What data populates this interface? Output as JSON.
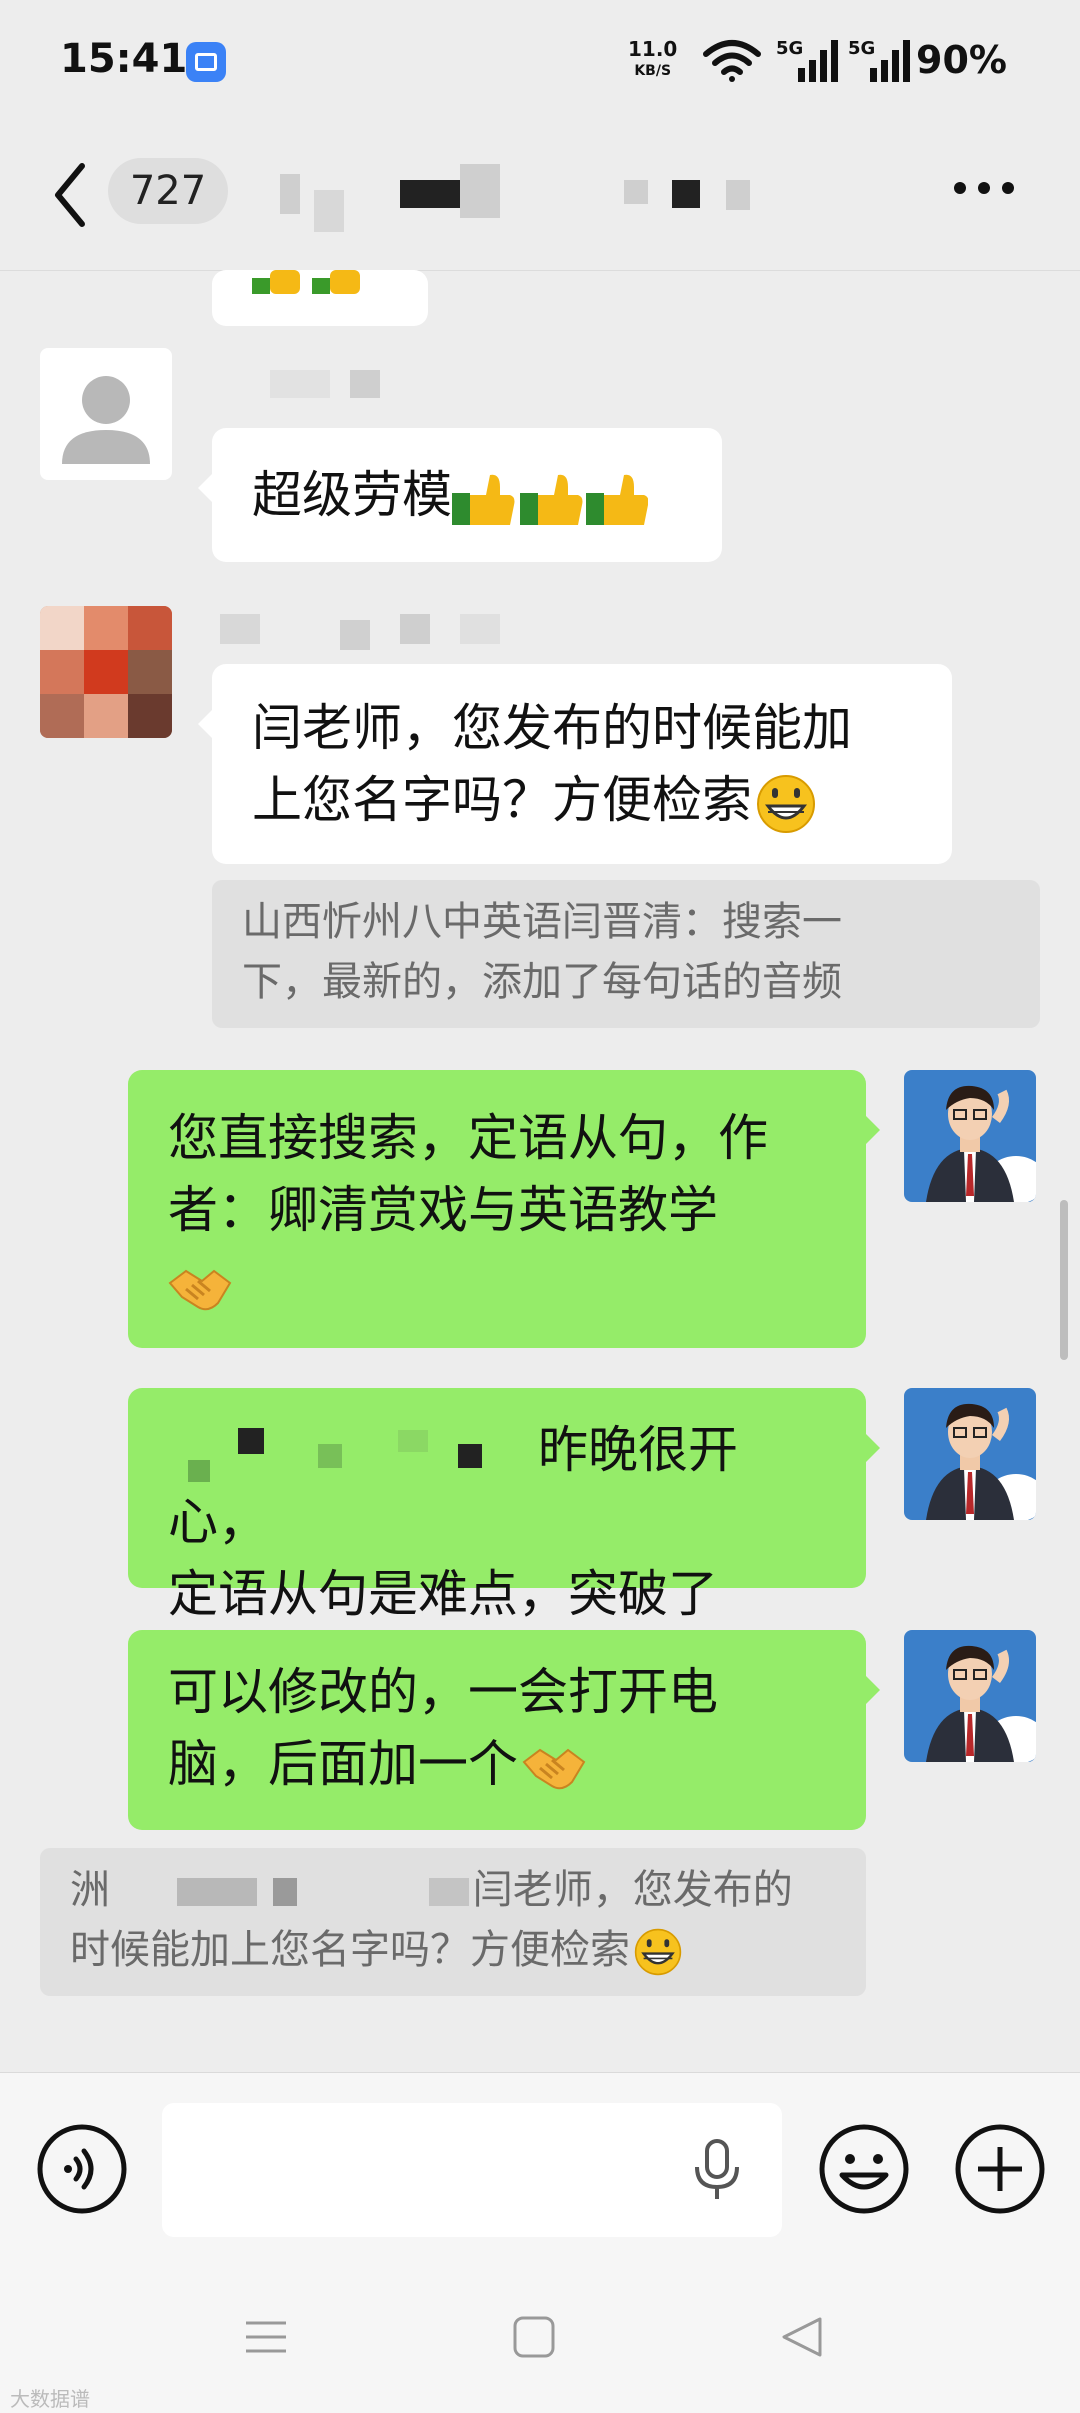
{
  "status_bar": {
    "time": "15:41",
    "net_speed": "11.0",
    "net_unit": "KB/S",
    "signal1_label": "5G",
    "signal2_label": "5G",
    "battery": "90%"
  },
  "header": {
    "unread_count": "727"
  },
  "messages": {
    "m1_text": "超级劳模",
    "m2_text_line1": "闫老师，您发布的时候能加",
    "m2_text_line2": "上您名字吗？方便检索",
    "m3_quote_line1": "山西忻州八中英语闫晋清：搜索一",
    "m3_quote_line2": "下，最新的，添加了每句话的音频",
    "m4_text_line1": "您直接搜索，定语从句，作",
    "m4_text_line2": "者：卿清赏戏与英语教学",
    "m5_text_line1": "昨晚很开心，",
    "m5_text_line2": "定语从句是难点，突破了",
    "m6_text_line1": "可以修改的，一会打开电",
    "m6_text_line2": "脑，后面加一个",
    "m7_quote_prefix": "洲",
    "m7_quote_line1": "闫老师，您发布的",
    "m7_quote_line2": "时候能加上您名字吗？方便检索"
  },
  "footer": {
    "watermark": "大数据谱"
  },
  "colors": {
    "background": "#ededed",
    "my_bubble": "#95ec69",
    "their_bubble": "#ffffff",
    "quote": "#e0e0e0"
  },
  "icons": [
    "back-arrow-icon",
    "more-icon",
    "voice-icon",
    "microphone-icon",
    "emoji-icon",
    "plus-icon",
    "thumbs-up-icon",
    "grin-emoji-icon",
    "handshake-icon"
  ]
}
